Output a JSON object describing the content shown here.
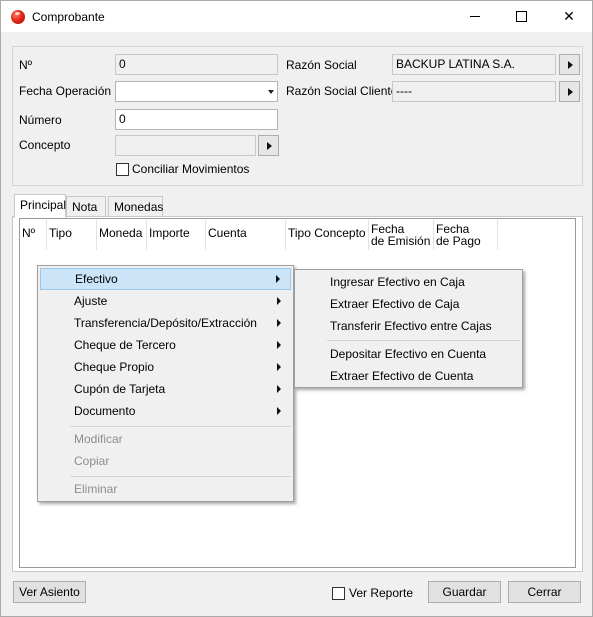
{
  "window": {
    "title": "Comprobante",
    "close_glyph": "✕"
  },
  "form": {
    "numero_label": "Nº",
    "numero_value": "0",
    "fecha_label": "Fecha Operación",
    "fecha_value": "",
    "numero2_label": "Número",
    "numero2_value": "0",
    "concepto_label": "Concepto",
    "concepto_value": "",
    "conciliar_label": "Conciliar Movimientos",
    "conciliar_checked": false,
    "razon_social_label": "Razón Social",
    "razon_social_value": "BACKUP LATINA S.A.",
    "razon_cliente_label": "Razón Social Cliente",
    "razon_cliente_value": "----"
  },
  "tabs": [
    {
      "label": "Principal",
      "active": true
    },
    {
      "label": "Nota",
      "active": false
    },
    {
      "label": "Monedas",
      "active": false
    }
  ],
  "grid": {
    "columns": [
      {
        "label": "Nº"
      },
      {
        "label": "Tipo"
      },
      {
        "label": "Moneda"
      },
      {
        "label": "Importe"
      },
      {
        "label": "Cuenta"
      },
      {
        "label": "Tipo Concepto"
      },
      {
        "label": "Fecha\nde Emisión"
      },
      {
        "label": "Fecha\nde Pago"
      }
    ]
  },
  "context_menu": {
    "items": [
      {
        "label": "Efectivo",
        "has_submenu": true,
        "highlighted": true
      },
      {
        "label": "Ajuste",
        "has_submenu": true
      },
      {
        "label": "Transferencia/Depósito/Extracción",
        "has_submenu": true
      },
      {
        "label": "Cheque de Tercero",
        "has_submenu": true
      },
      {
        "label": "Cheque Propio",
        "has_submenu": true
      },
      {
        "label": "Cupón de Tarjeta",
        "has_submenu": true
      },
      {
        "label": "Documento",
        "has_submenu": true
      },
      {
        "label": "Modificar",
        "disabled": true
      },
      {
        "label": "Copiar",
        "disabled": true
      },
      {
        "label": "Eliminar",
        "disabled": true
      }
    ]
  },
  "submenu": {
    "items": [
      {
        "label": "Ingresar Efectivo en Caja"
      },
      {
        "label": "Extraer Efectivo de Caja"
      },
      {
        "label": "Transferir Efectivo entre Cajas"
      },
      {
        "label": "Depositar Efectivo en Cuenta"
      },
      {
        "label": "Extraer Efectivo de Cuenta"
      }
    ]
  },
  "footer": {
    "ver_asiento": "Ver Asiento",
    "ver_reporte": "Ver Reporte",
    "ver_reporte_checked": false,
    "guardar": "Guardar",
    "cerrar": "Cerrar"
  },
  "colors": {
    "window_bg": "#f0f0f0",
    "menu_highlight": "#cce4f7",
    "menu_highlight_border": "#99c9ef",
    "disabled_text": "#8d8d8d"
  }
}
